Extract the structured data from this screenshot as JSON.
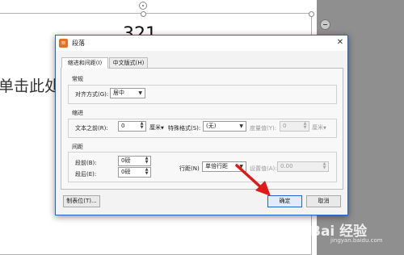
{
  "document": {
    "number_text": "321",
    "placeholder_text": "单击此处"
  },
  "dialog": {
    "title": "段落",
    "app_icon_glyph": "≡",
    "close_glyph": "✕",
    "tabs": [
      {
        "label": "缩进和间距(I)",
        "selected": true
      },
      {
        "label": "中文版式(H)",
        "selected": false
      }
    ],
    "general": {
      "section_title": "常规",
      "alignment_label": "对齐方式(G):",
      "alignment_value": "居中"
    },
    "indent": {
      "section_title": "缩进",
      "before_text_label": "文本之前(R):",
      "before_text_value": "0",
      "before_text_unit": "厘米",
      "special_label": "特殊格式(S):",
      "special_value": "(无)",
      "measure_label": "度量值(Y):",
      "measure_value": "0",
      "measure_unit": "厘米"
    },
    "spacing": {
      "section_title": "间距",
      "before_label": "段前(B):",
      "before_value": "0磅",
      "after_label": "段后(E):",
      "after_value": "0磅",
      "line_spacing_label": "行距(N)",
      "line_spacing_value": "单倍行距",
      "set_value_label": "设置值(A):",
      "set_value_value": "0.00"
    },
    "buttons": {
      "tabs_label": "制表位(T)...",
      "ok_label": "确定",
      "cancel_label": "取消"
    }
  },
  "watermark": {
    "text": "Bai 经验",
    "sub_text": "jingyan.baidu.com"
  },
  "colors": {
    "accent": "#1e66c9",
    "app_icon": "#e96f22",
    "annotation_arrow": "#e01818"
  }
}
